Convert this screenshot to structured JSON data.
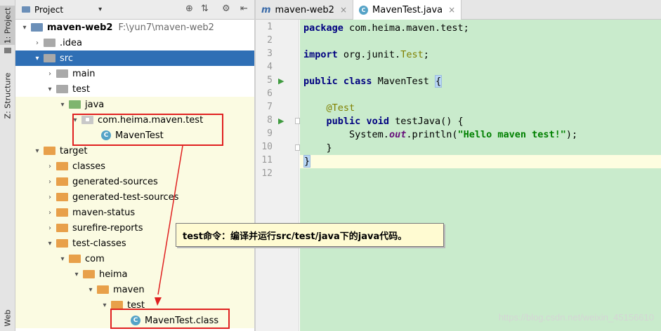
{
  "tool_strip": {
    "project_tab": "1: Project",
    "structure_tab": "Z: Structure",
    "web_tab": "Web"
  },
  "project_panel": {
    "title": "Project",
    "caret": "▾",
    "header_buttons": [
      "⊕",
      "⇅",
      "⚙",
      "⇤"
    ],
    "tree": [
      {
        "label": "maven-web2",
        "path": "F:\\yun7\\maven-web2",
        "arrow": "▾",
        "icon": "folder-blue"
      },
      {
        "label": ".idea",
        "arrow": "›",
        "icon": "folder-grey"
      },
      {
        "label": "src",
        "arrow": "▾",
        "icon": "folder-grey"
      },
      {
        "label": "main",
        "arrow": "›",
        "icon": "folder-grey"
      },
      {
        "label": "test",
        "arrow": "▾",
        "icon": "folder-grey"
      },
      {
        "label": "java",
        "arrow": "▾",
        "icon": "folder-green"
      },
      {
        "label": "com.heima.maven.test",
        "arrow": "▾",
        "icon": "package"
      },
      {
        "label": "MavenTest",
        "arrow": "",
        "icon": "class-c"
      },
      {
        "label": "target",
        "arrow": "▾",
        "icon": "folder-orange"
      },
      {
        "label": "classes",
        "arrow": "›",
        "icon": "folder-orange"
      },
      {
        "label": "generated-sources",
        "arrow": "›",
        "icon": "folder-orange"
      },
      {
        "label": "generated-test-sources",
        "arrow": "›",
        "icon": "folder-orange"
      },
      {
        "label": "maven-status",
        "arrow": "›",
        "icon": "folder-orange"
      },
      {
        "label": "surefire-reports",
        "arrow": "›",
        "icon": "folder-orange"
      },
      {
        "label": "test-classes",
        "arrow": "▾",
        "icon": "folder-orange"
      },
      {
        "label": "com",
        "arrow": "▾",
        "icon": "folder-orange"
      },
      {
        "label": "heima",
        "arrow": "▾",
        "icon": "folder-orange"
      },
      {
        "label": "maven",
        "arrow": "▾",
        "icon": "folder-orange"
      },
      {
        "label": "test",
        "arrow": "▾",
        "icon": "folder-orange"
      },
      {
        "label": "MavenTest.class",
        "arrow": "",
        "icon": "class-c"
      }
    ]
  },
  "editor": {
    "tabs": [
      {
        "label": "maven-web2",
        "icon_glyph": "m",
        "close": "×"
      },
      {
        "label": "MavenTest.java",
        "icon_glyph": "C",
        "close": "×"
      }
    ],
    "line_numbers": [
      "1",
      "2",
      "3",
      "4",
      "5",
      "6",
      "7",
      "8",
      "9",
      "10",
      "11",
      "12"
    ],
    "code": {
      "l1_kw": "package",
      "l1_rest": " com.heima.maven.test;",
      "l3_kw": "import",
      "l3_pkg": " org.junit.",
      "l3_type": "Test",
      "l3_semi": ";",
      "l5_kw1": "public",
      "l5_kw2": "class",
      "l5_name": " MavenTest ",
      "l5_brace": "{",
      "l7_anno": "@Test",
      "l8_kw1": "public",
      "l8_kw2": "void",
      "l8_rest": " testJava() {",
      "l9_sys": "System.",
      "l9_out": "out",
      "l9_call": ".println(",
      "l9_str": "\"Hello maven test!\"",
      "l9_end": ");",
      "l10": "}",
      "l11": "}"
    },
    "run_glyph": "▶"
  },
  "callout": {
    "text": "test命令：编译并运行src/test/java下的java代码。"
  },
  "watermark": "https://blog.csdn.net/weixin_45156610",
  "colors": {
    "selection": "#2f6fb5",
    "code_background": "#c9ebcc",
    "annotation_red": "#e02020",
    "callout_background": "#fffbd2"
  }
}
